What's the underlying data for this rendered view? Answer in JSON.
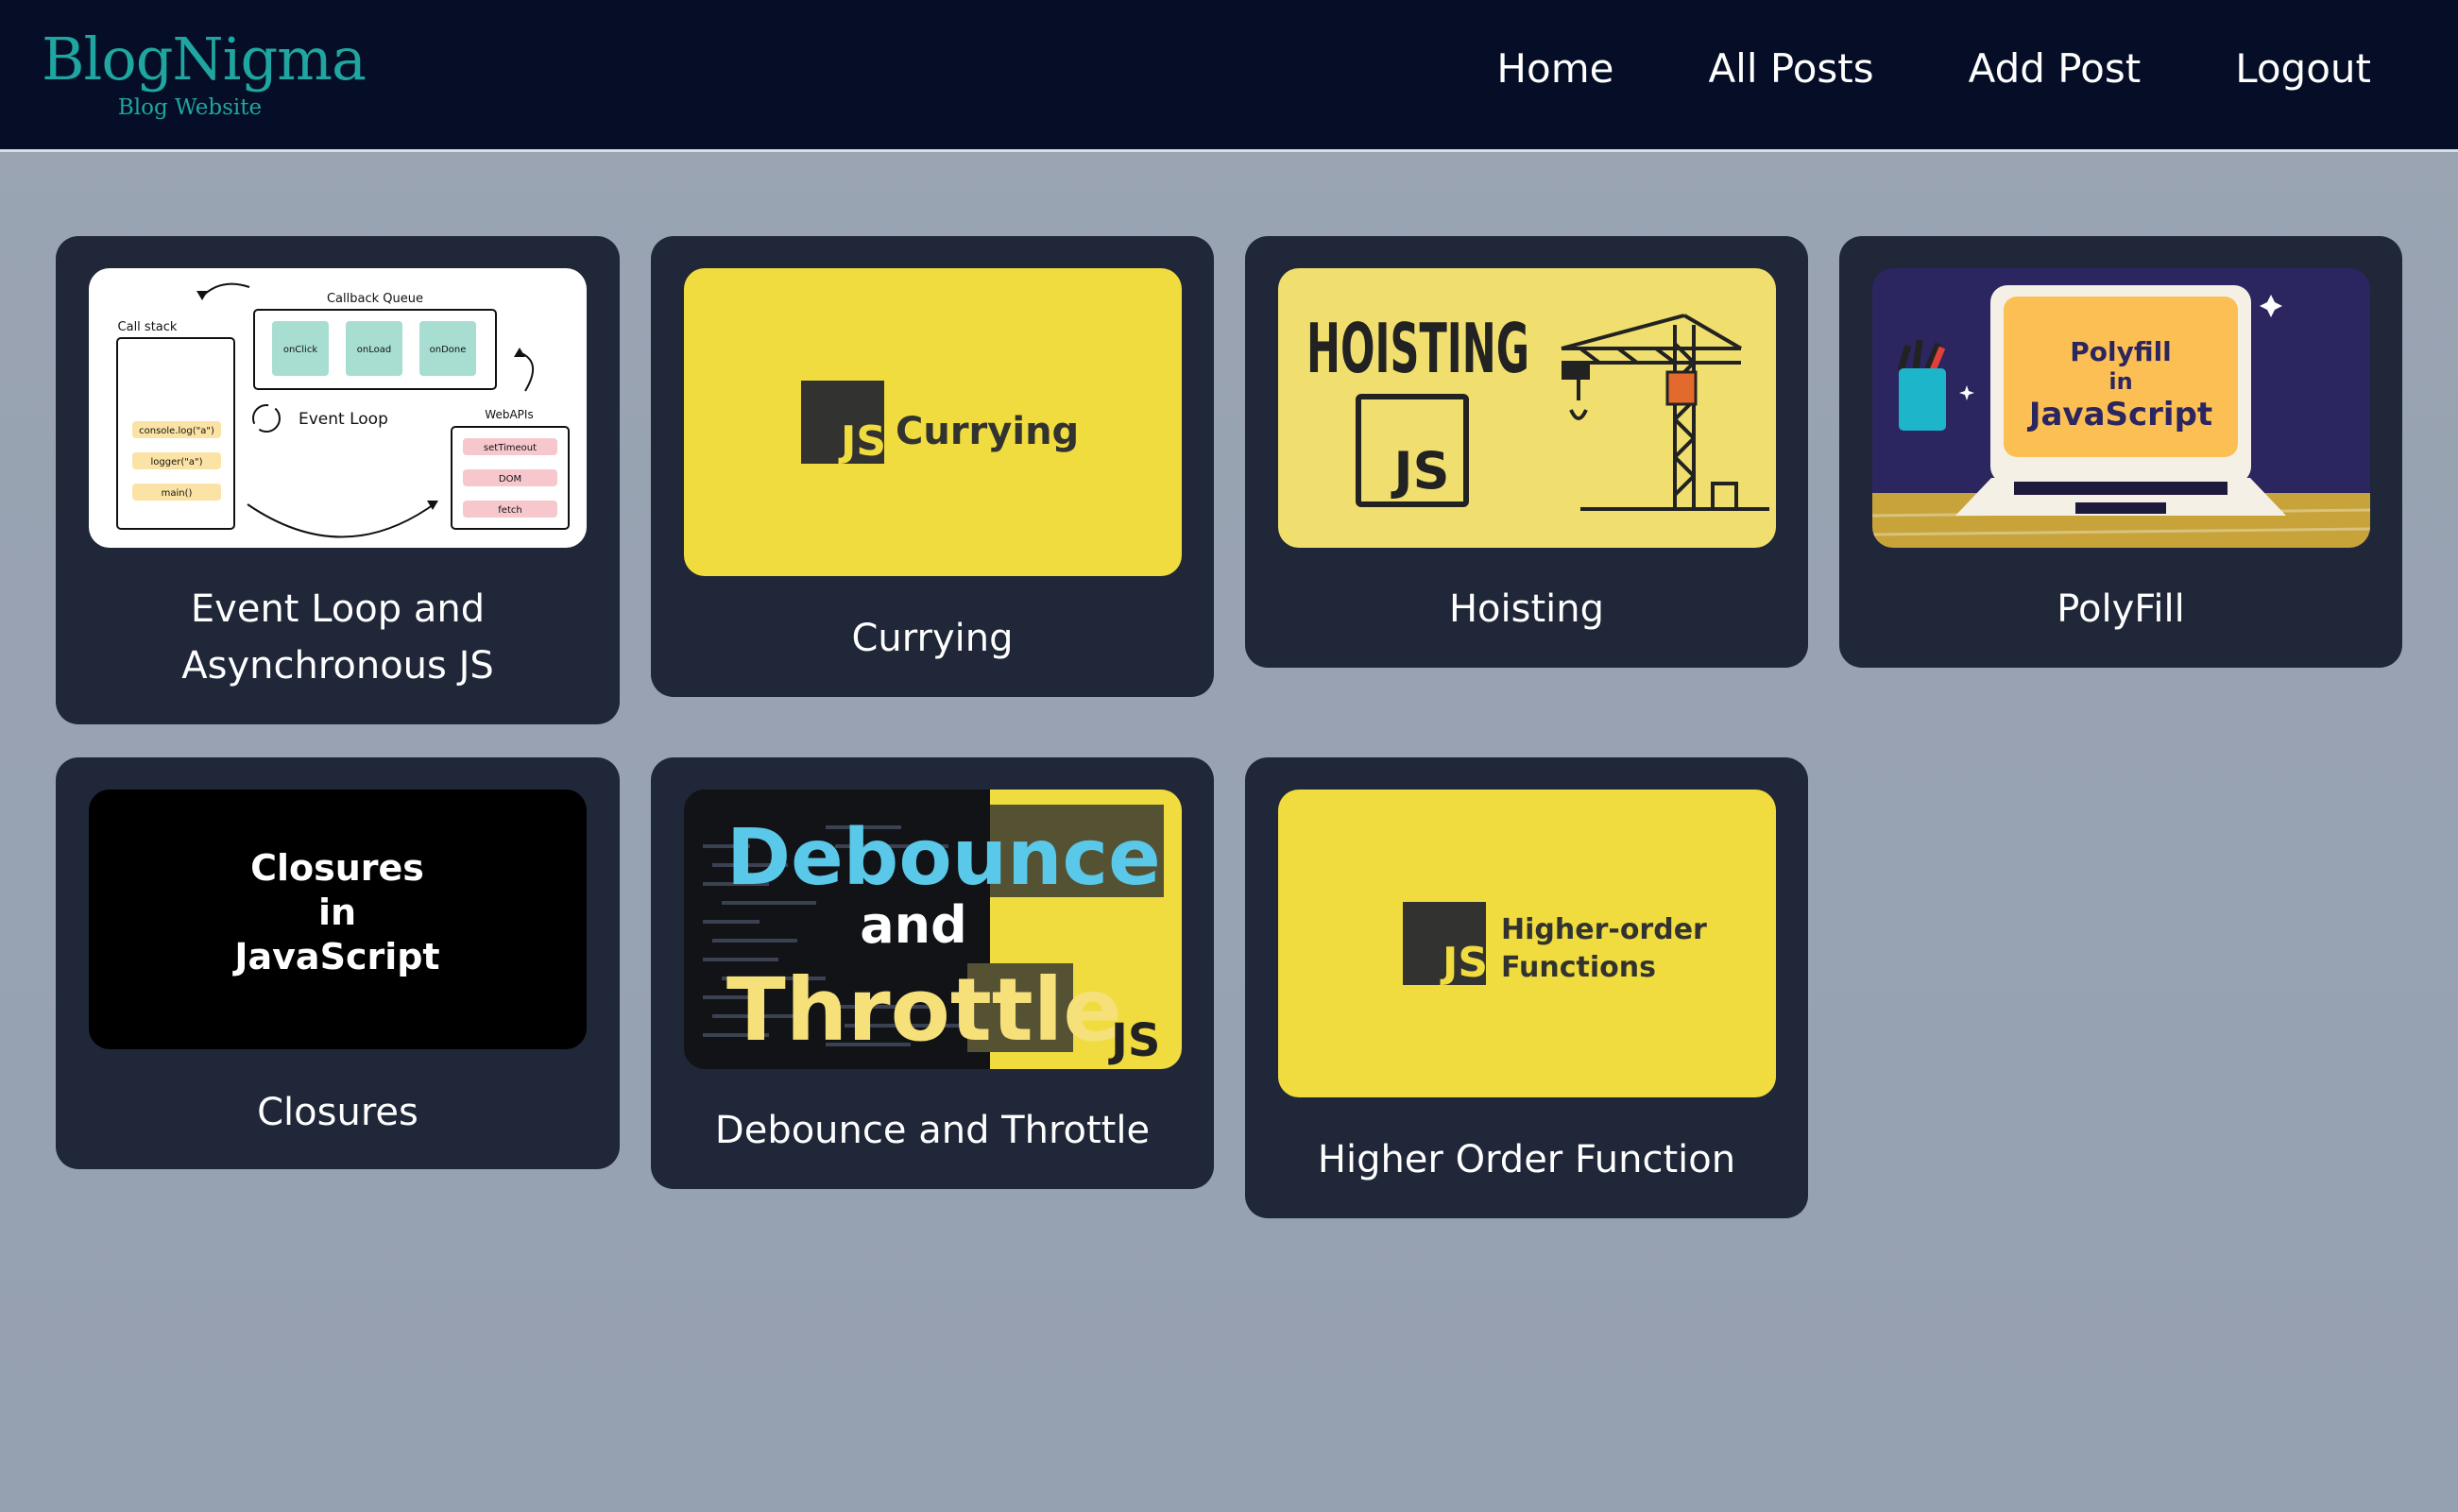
{
  "brand": {
    "title": "BlogNigma",
    "subtitle": "Blog Website"
  },
  "nav": {
    "home": "Home",
    "all_posts": "All Posts",
    "add_post": "Add Post",
    "logout": "Logout"
  },
  "posts": [
    {
      "title_line1": "Event Loop and",
      "title_line2": "Asynchronous JS",
      "thumb": {
        "call_stack": "Call stack",
        "callback_queue": "Callback Queue",
        "event_loop": "Event Loop",
        "web_apis": "WebAPIs",
        "queue_items": [
          "onClick",
          "onLoad",
          "onDone"
        ],
        "stack_items": [
          "console.log(\"a\")",
          "logger(\"a\")",
          "main()"
        ],
        "api_items": [
          "setTimeout",
          "DOM",
          "fetch"
        ]
      }
    },
    {
      "title": "Currying",
      "thumb": {
        "logo": "JS",
        "label": "Currying"
      }
    },
    {
      "title": "Hoisting",
      "thumb": {
        "heading": "HOISTING",
        "logo": "JS"
      }
    },
    {
      "title": "PolyFill",
      "thumb": {
        "line1": "Polyfill",
        "line2": "in",
        "line3": "JavaScript"
      }
    },
    {
      "title": "Closures",
      "thumb": {
        "line1": "Closures",
        "line2": "in",
        "line3": "JavaScript"
      }
    },
    {
      "title": "Debounce and Throttle",
      "thumb": {
        "word1": "Debounce",
        "word2": "and",
        "word3": "Throttle",
        "logo": "JS"
      }
    },
    {
      "title": "Higher Order Function",
      "thumb": {
        "logo": "JS",
        "line1": "Higher-order",
        "line2": "Functions"
      }
    }
  ],
  "colors": {
    "header_bg": "#050e26",
    "brand": "#1fa6a0",
    "card_bg": "#1f2738",
    "js_yellow": "#f0dc3e"
  }
}
